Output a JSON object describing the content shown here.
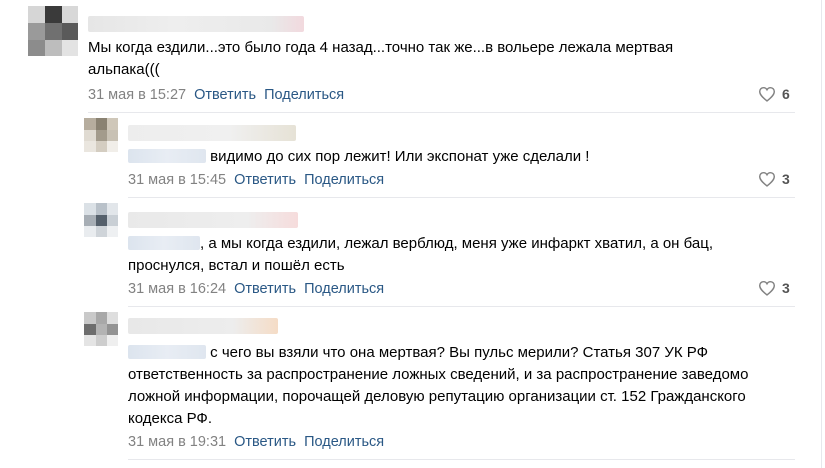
{
  "comments": [
    {
      "text": "Мы когда ездили...это было года 4 назад...точно так же...в вольере лежала мертвая альпака(((",
      "date": "31 мая в 15:27",
      "reply_label": "Ответить",
      "share_label": "Поделиться",
      "likes": "6"
    },
    {
      "text": "видимо до сих пор лежит! Или экспонат уже сделали !",
      "date": "31 мая в 15:45",
      "reply_label": "Ответить",
      "share_label": "Поделиться",
      "likes": "3"
    },
    {
      "text": ", а мы когда ездили, лежал верблюд, меня уже инфаркт хватил, а он бац, проснулся, встал и пошёл есть",
      "date": "31 мая в 16:24",
      "reply_label": "Ответить",
      "share_label": "Поделиться",
      "likes": "3"
    },
    {
      "text": "с чего вы взяли что она мертвая? Вы пульс мерили? Статья 307 УК РФ ответственность за распространение ложных сведений, и за распространение заведомо ложной информации, порочащей деловую репутацию организации ст. 152 Гражданского кодекса РФ.",
      "date": "31 мая в 19:31",
      "reply_label": "Ответить",
      "share_label": "Поделиться"
    }
  ],
  "colors": {
    "link": "#2a5885",
    "meta": "#828282",
    "divider": "#e7e8ec"
  },
  "icons": {
    "like": "heart-icon"
  }
}
